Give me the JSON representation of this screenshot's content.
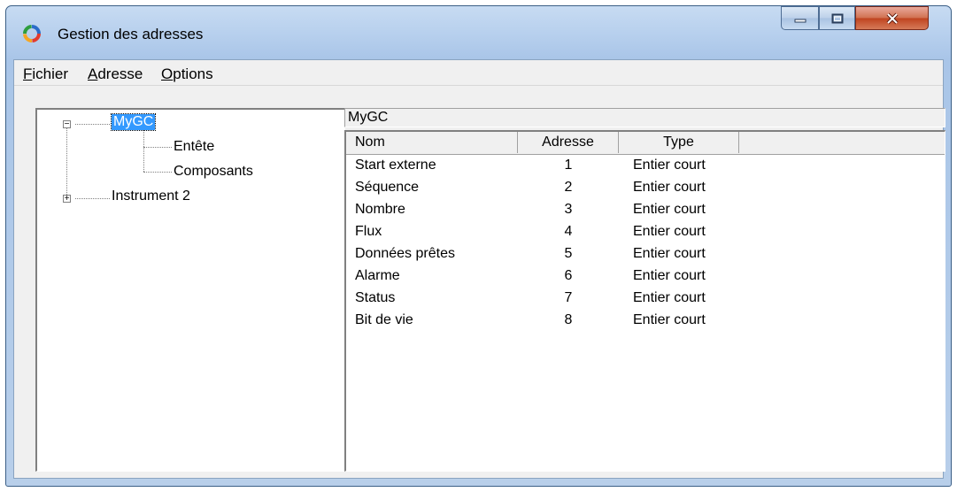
{
  "window": {
    "title": "Gestion des adresses"
  },
  "menu": [
    {
      "label_ul": "F",
      "label_rest": "ichier"
    },
    {
      "label_ul": "A",
      "label_rest": "dresse"
    },
    {
      "label_ul": "O",
      "label_rest": "ptions"
    }
  ],
  "tree": {
    "root": {
      "label": "MyGC",
      "expanded": true
    },
    "children": [
      {
        "label": "Entête"
      },
      {
        "label": "Composants"
      }
    ],
    "instrument2": {
      "label": "Instrument 2",
      "expanded": false
    }
  },
  "path": "MyGC",
  "table": {
    "headers": [
      "Nom",
      "Adresse",
      "Type"
    ],
    "rows": [
      {
        "nom": "Start externe",
        "adresse": "1",
        "type": "Entier court"
      },
      {
        "nom": "Séquence",
        "adresse": "2",
        "type": "Entier court"
      },
      {
        "nom": "Nombre",
        "adresse": "3",
        "type": "Entier court"
      },
      {
        "nom": "Flux",
        "adresse": "4",
        "type": "Entier court"
      },
      {
        "nom": "Données prêtes",
        "adresse": "5",
        "type": "Entier court"
      },
      {
        "nom": "Alarme",
        "adresse": "6",
        "type": "Entier court"
      },
      {
        "nom": "Status",
        "adresse": "7",
        "type": "Entier court"
      },
      {
        "nom": "Bit de vie",
        "adresse": "8",
        "type": "Entier court"
      }
    ]
  },
  "icons": {
    "app": "colored-ring-icon",
    "minimize": "minimize-icon",
    "maximize": "maximize-icon",
    "close": "close-icon"
  },
  "colors": {
    "selection": "#3399ff",
    "close_button": "#c0431f"
  }
}
